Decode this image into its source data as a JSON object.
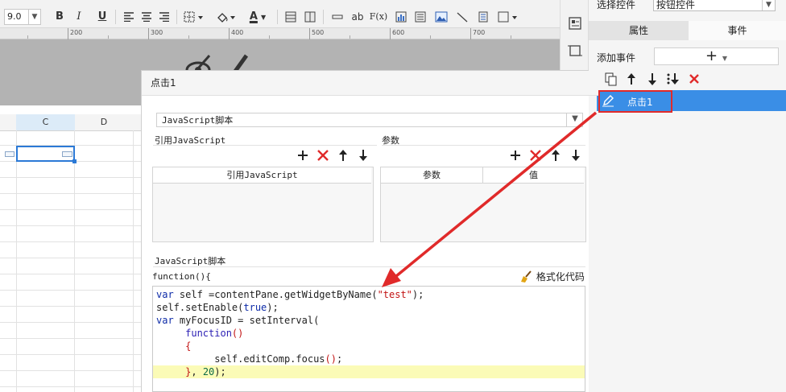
{
  "toolbar": {
    "font_size": "9.0",
    "bold": "B",
    "italic": "I",
    "underline": "U",
    "text_label": "ab",
    "font_color_glyph": "A",
    "formula_glyph": "F(x)"
  },
  "ruler": {
    "marks": [
      "200",
      "300",
      "400",
      "500",
      "600",
      "700"
    ]
  },
  "sheet": {
    "columns": [
      "C",
      "D"
    ]
  },
  "right_panel": {
    "select_label": "选择控件",
    "select_value": "按钮控件",
    "tabs": [
      "属性",
      "事件"
    ],
    "add_event_label": "添加事件",
    "add_event_btn": "+",
    "event_item": "点击1"
  },
  "dialog": {
    "title": "点击1",
    "type_select": "JavaScript脚本",
    "ref_js_label": "引用JavaScript",
    "params_label": "参数",
    "ref_js_column": "引用JavaScript",
    "param_columns": [
      "参数",
      "值"
    ],
    "script_label": "JavaScript脚本",
    "function_header": "function(){",
    "format_button": "格式化代码"
  },
  "colors": {
    "accent": "#3a8ee6",
    "arrow": "#e02a2a",
    "highlight_line": "#fbfbb7",
    "keyword": "#0d2ba8",
    "string": "#c21414"
  }
}
